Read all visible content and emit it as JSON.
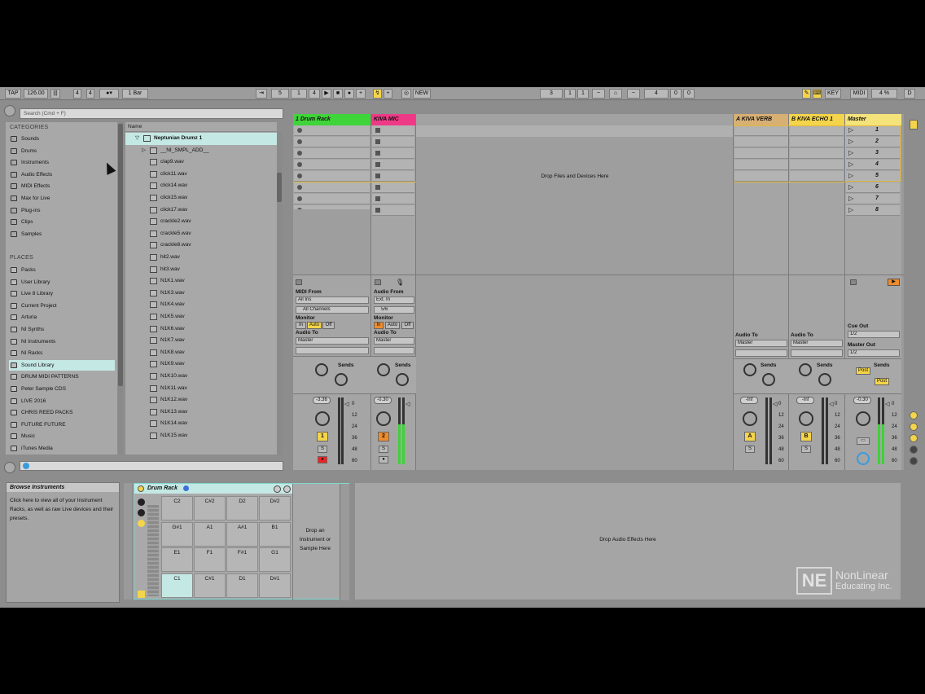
{
  "control_bar": {
    "tap": "TAP",
    "tempo": "126.00",
    "sig_num": "4",
    "sig_den": "4",
    "quantize": "1 Bar",
    "arr_pos": [
      "5",
      "1",
      "4"
    ],
    "new_label": "NEW",
    "loop_start": [
      "3",
      "1",
      "1"
    ],
    "loop_len": [
      "4",
      "0",
      "0"
    ],
    "key": "KEY",
    "midi": "MIDI",
    "cpu": "4 %",
    "d": "D"
  },
  "browser": {
    "search_placeholder": "Search (Cmd + F)",
    "categories_title": "CATEGORIES",
    "categories": [
      {
        "label": "Sounds",
        "icon": "note-icon"
      },
      {
        "label": "Drums",
        "icon": "drum-icon"
      },
      {
        "label": "Instruments",
        "icon": "wave-icon"
      },
      {
        "label": "Audio Effects",
        "icon": "fx-icon"
      },
      {
        "label": "MIDI Effects",
        "icon": "midi-icon"
      },
      {
        "label": "Max for Live",
        "icon": "max-icon"
      },
      {
        "label": "Plug-ins",
        "icon": "plug-icon"
      },
      {
        "label": "Clips",
        "icon": "clip-icon"
      },
      {
        "label": "Samples",
        "icon": "sample-icon"
      }
    ],
    "places_title": "PLACES",
    "places": [
      "Packs",
      "User Library",
      "Live 8 Library",
      "Current Project",
      "Arturia",
      "NI Synths",
      "NI Instruments",
      "NI Racks",
      "Sound Library",
      "DRUM MIDI PATTERNS",
      "Peter Sample CDS",
      "LIVE 2016",
      "CHRIS REED PACKS",
      "FUTURE FUTURE",
      "Music",
      "iTunes Media"
    ],
    "selected_place": "Sound Library",
    "files_header": "Name",
    "folder": "Neptunian Drumz 1",
    "subfolder": "__NI_SMPL_ADD__",
    "files": [
      "clap9.wav",
      "click11.wav",
      "click14.wav",
      "click15.wav",
      "click17.wav",
      "crackle2.wav",
      "crackle5.wav",
      "crackle8.wav",
      "hit2.wav",
      "hit3.wav",
      "N1K1.wav",
      "N1K3.wav",
      "N1K4.wav",
      "N1K5.wav",
      "N1K6.wav",
      "N1K7.wav",
      "N1K8.wav",
      "N1K9.wav",
      "N1K10.wav",
      "N1K11.wav",
      "N1K12.wav",
      "N1K13.wav",
      "N1K14.wav",
      "N1K15.wav"
    ]
  },
  "session": {
    "tracks": [
      {
        "name": "1 Drum Rack",
        "color": "#3fd43a",
        "number": "1",
        "num_color": "#f4d44a",
        "vol": "-3.36"
      },
      {
        "name": "KIVA MIC",
        "color": "#ee3a86",
        "number": "2",
        "num_color": "#f08b2a",
        "vol": "-0.30"
      }
    ],
    "drop_label": "Drop Files and Devices Here",
    "returns": [
      {
        "name": "A KIVA VERB",
        "color": "#d8b074",
        "letter": "A",
        "vol": "-Inf"
      },
      {
        "name": "B KIVA ECHO 1",
        "color": "#f4d44a",
        "letter": "B",
        "vol": "-Inf"
      }
    ],
    "master": {
      "name": "Master",
      "color": "#f4e27a",
      "scenes": [
        "1",
        "2",
        "3",
        "4",
        "5",
        "6",
        "7",
        "8"
      ],
      "vol": "-0.30"
    },
    "mixer": {
      "midi_from": "MIDI From",
      "all_ins": "All Ins",
      "all_channels": "All Channels",
      "audio_from": "Audio From",
      "ext_in": "Ext. In",
      "ch56": "5/6",
      "monitor": "Monitor",
      "mon_in": "In",
      "mon_auto": "Auto",
      "mon_off": "Off",
      "audio_to": "Audio To",
      "master": "Master",
      "sends": "Sends",
      "knob_a": "A",
      "knob_b": "B",
      "solo": "S",
      "cue_out": "Cue Out",
      "cue_val": "1/2",
      "master_out": "Master Out",
      "master_val": "1/2",
      "post": "Post",
      "scale": [
        "0",
        "12",
        "24",
        "36",
        "48",
        "60"
      ]
    }
  },
  "detail": {
    "info_title": "Browse Instruments",
    "info_text": "Click here to view all of your Instrument Racks, as well as raw Live devices and their presets.",
    "rack_title": "Drum Rack",
    "pads": [
      [
        "C2",
        "C#2",
        "D2",
        "D#2"
      ],
      [
        "G#1",
        "A1",
        "A#1",
        "B1"
      ],
      [
        "E1",
        "F1",
        "F#1",
        "G1"
      ],
      [
        "C1",
        "C#1",
        "D1",
        "D#1"
      ]
    ],
    "drop_instrument": "Drop an Instrument or Sample Here",
    "drop_fx": "Drop Audio Effects Here"
  },
  "watermark": {
    "logo": "NE",
    "line1": "NonLinear",
    "line2": "Educating Inc."
  }
}
